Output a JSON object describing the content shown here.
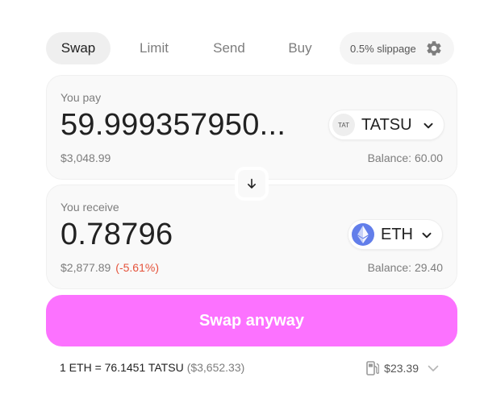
{
  "tabs": [
    {
      "label": "Swap",
      "active": true
    },
    {
      "label": "Limit",
      "active": false
    },
    {
      "label": "Send",
      "active": false
    },
    {
      "label": "Buy",
      "active": false
    }
  ],
  "settings": {
    "slippage_label": "0.5% slippage",
    "icon": "gear-icon"
  },
  "pay": {
    "label": "You pay",
    "amount": "59.999357950...",
    "usd_value": "$3,048.99",
    "balance": "Balance: 60.00",
    "token": {
      "logo_text": "TAT",
      "symbol": "TATSU",
      "icon": "chevron-down-icon"
    }
  },
  "switch": {
    "icon": "arrow-down-icon"
  },
  "receive": {
    "label": "You receive",
    "amount": "0.78796",
    "usd_value": "$2,877.89",
    "price_impact": "(-5.61%)",
    "balance": "Balance: 29.40",
    "token": {
      "symbol": "ETH",
      "logo_icon": "ethereum-icon",
      "icon": "chevron-down-icon"
    }
  },
  "action": {
    "label": "Swap anyway"
  },
  "rate": {
    "text": "1 ETH = 76.1451 TATSU",
    "usd": "($3,652.33)"
  },
  "gas": {
    "icon": "gas-pump-icon",
    "value": "$23.39"
  },
  "colors": {
    "accent": "#fc72ff",
    "negative": "#e5533b",
    "eth": "#627eea",
    "panel": "#f9f9f9",
    "muted_text": "#7d7d7d"
  }
}
